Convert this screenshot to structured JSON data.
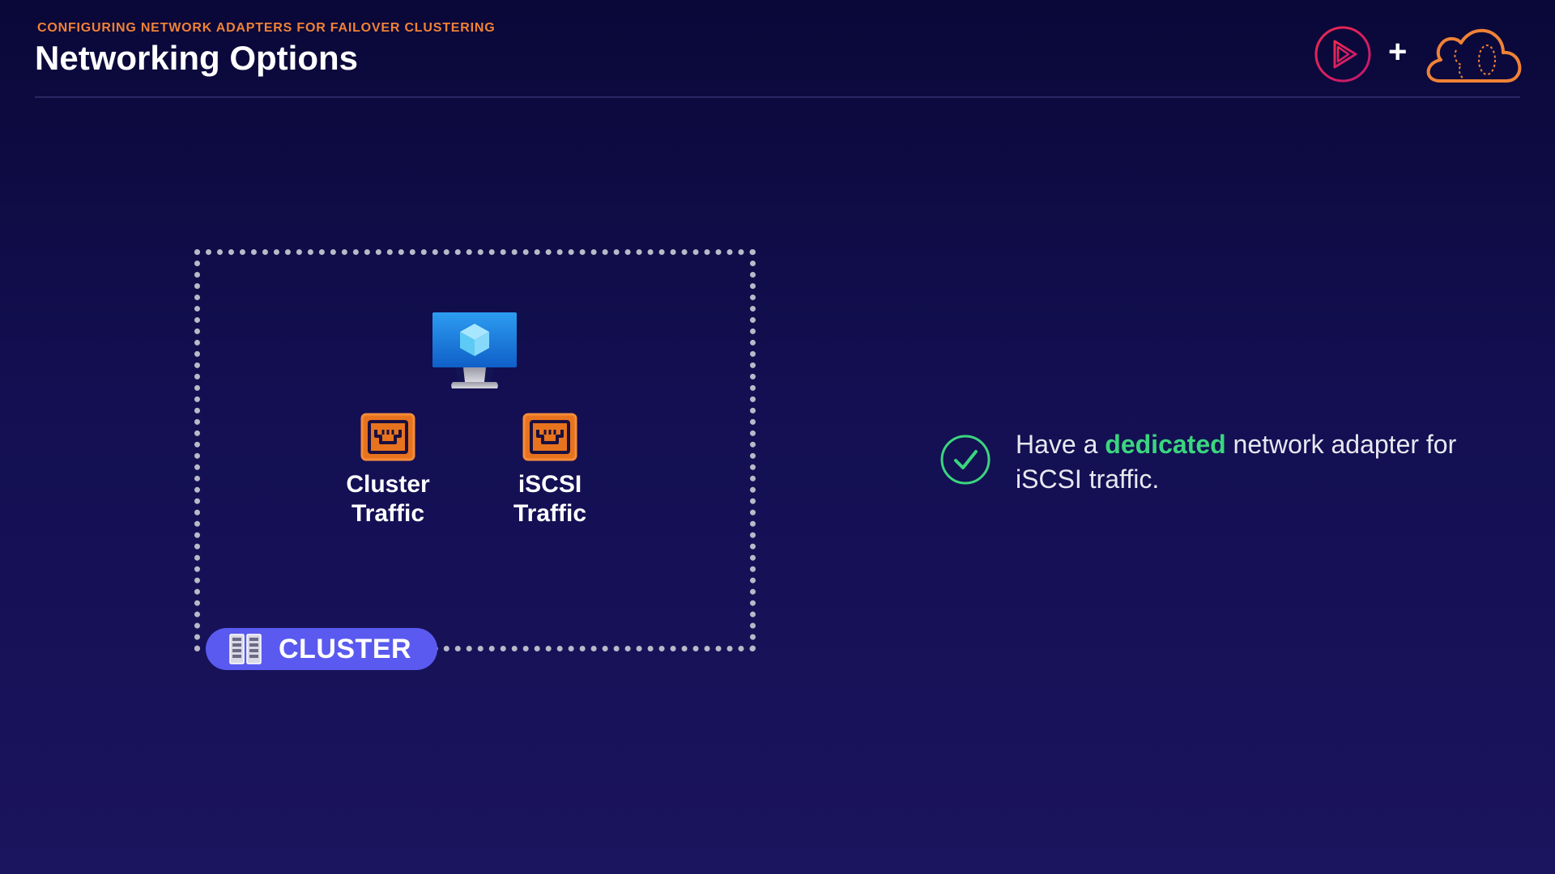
{
  "header": {
    "subtitle": "CONFIGURING NETWORK ADAPTERS FOR FAILOVER CLUSTERING",
    "title": "Networking Options",
    "plus": "+"
  },
  "diagram": {
    "vm_icon": "virtual-machine-monitor-icon",
    "adapters": [
      {
        "label_line1": "Cluster",
        "label_line2": "Traffic",
        "icon": "network-port-icon"
      },
      {
        "label_line1": "iSCSI",
        "label_line2": "Traffic",
        "icon": "network-port-icon"
      }
    ],
    "cluster_badge": {
      "label": "CLUSTER",
      "icon": "server-rack-icon"
    }
  },
  "statement": {
    "prefix": "Have a ",
    "highlight": "dedicated",
    "suffix": " network adapter for iSCSI traffic.",
    "icon": "check-circle-icon"
  },
  "colors": {
    "accent_orange": "#f08236",
    "accent_green": "#3ad67e",
    "badge_blue": "#5a5af0",
    "brand_pink": "#e8305a"
  }
}
